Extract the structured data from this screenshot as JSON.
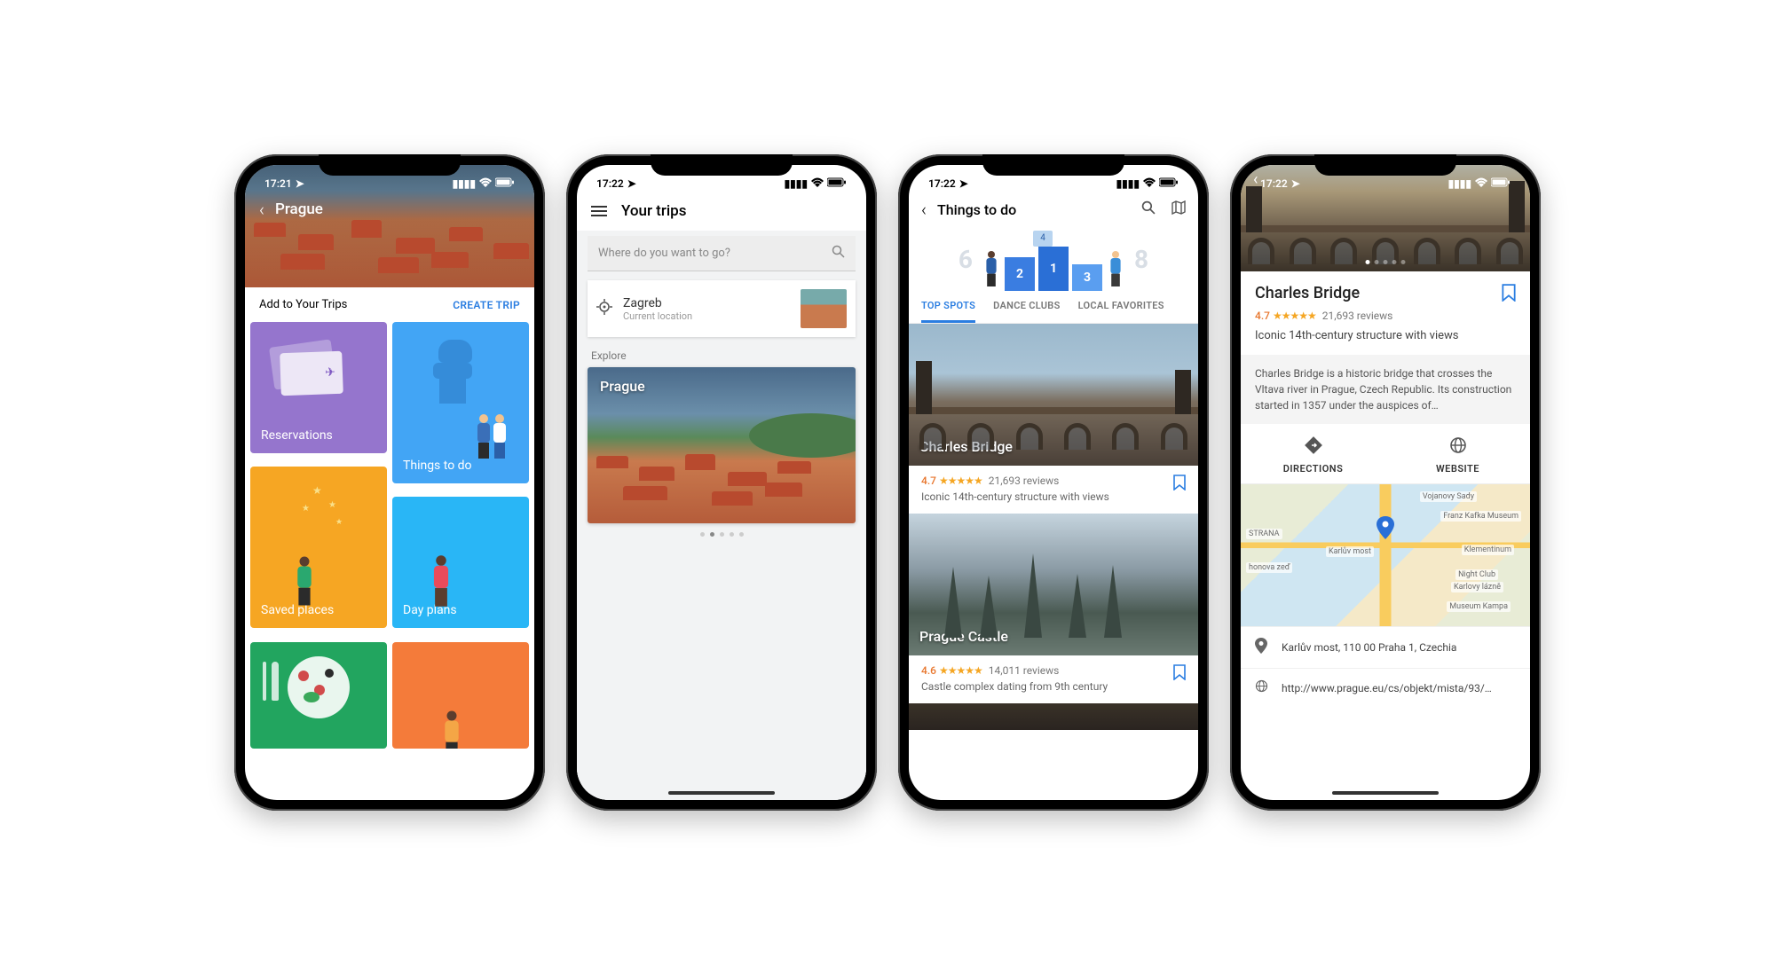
{
  "status": {
    "times": [
      "17:21",
      "17:22",
      "17:22",
      "17:22"
    ]
  },
  "screen1": {
    "city": "Prague",
    "subbar_label": "Add to Your Trips",
    "create_trip": "CREATE TRIP",
    "tiles": {
      "reservations": "Reservations",
      "things": "Things to do",
      "saved": "Saved places",
      "day": "Day plans"
    }
  },
  "screen2": {
    "title": "Your trips",
    "search_placeholder": "Where do you want to go?",
    "current_city": "Zagreb",
    "current_sub": "Current location",
    "explore_label": "Explore",
    "card_city": "Prague"
  },
  "screen3": {
    "title": "Things to do",
    "tabs": [
      "TOP SPOTS",
      "DANCE CLUBS",
      "LOCAL FAVORITES"
    ],
    "podium": [
      "2",
      "1",
      "3"
    ],
    "podium_side": [
      "6",
      "4",
      "8"
    ],
    "spots": [
      {
        "name": "Charles Bridge",
        "rating": "4.7",
        "reviews": "21,693 reviews",
        "desc": "Iconic 14th-century structure with views"
      },
      {
        "name": "Prague Castle",
        "rating": "4.6",
        "reviews": "14,011 reviews",
        "desc": "Castle complex dating from 9th century"
      }
    ]
  },
  "screen4": {
    "title": "Charles Bridge",
    "rating": "4.7",
    "reviews": "21,693 reviews",
    "tagline": "Iconic 14th-century structure with views",
    "description": "Charles Bridge is a historic bridge that crosses the Vltava river in Prague, Czech Republic. Its construction started in 1357 under the auspices of…",
    "actions": {
      "directions": "DIRECTIONS",
      "website": "WEBSITE"
    },
    "map_labels": {
      "strana": "STRANA",
      "karluv": "Karlův most",
      "klementinum": "Klementinum",
      "nightclub": "Night Club",
      "karlovy": "Karlovy lázně",
      "kampa": "Museum Kampa",
      "kafka": "Franz Kafka Museum",
      "vojanovy": "Vojanovy Sady",
      "novazed": "honova zeď"
    },
    "address": "Karlův most, 110 00 Praha 1, Czechia",
    "website": "http://www.prague.eu/cs/objekt/mista/93/…"
  }
}
